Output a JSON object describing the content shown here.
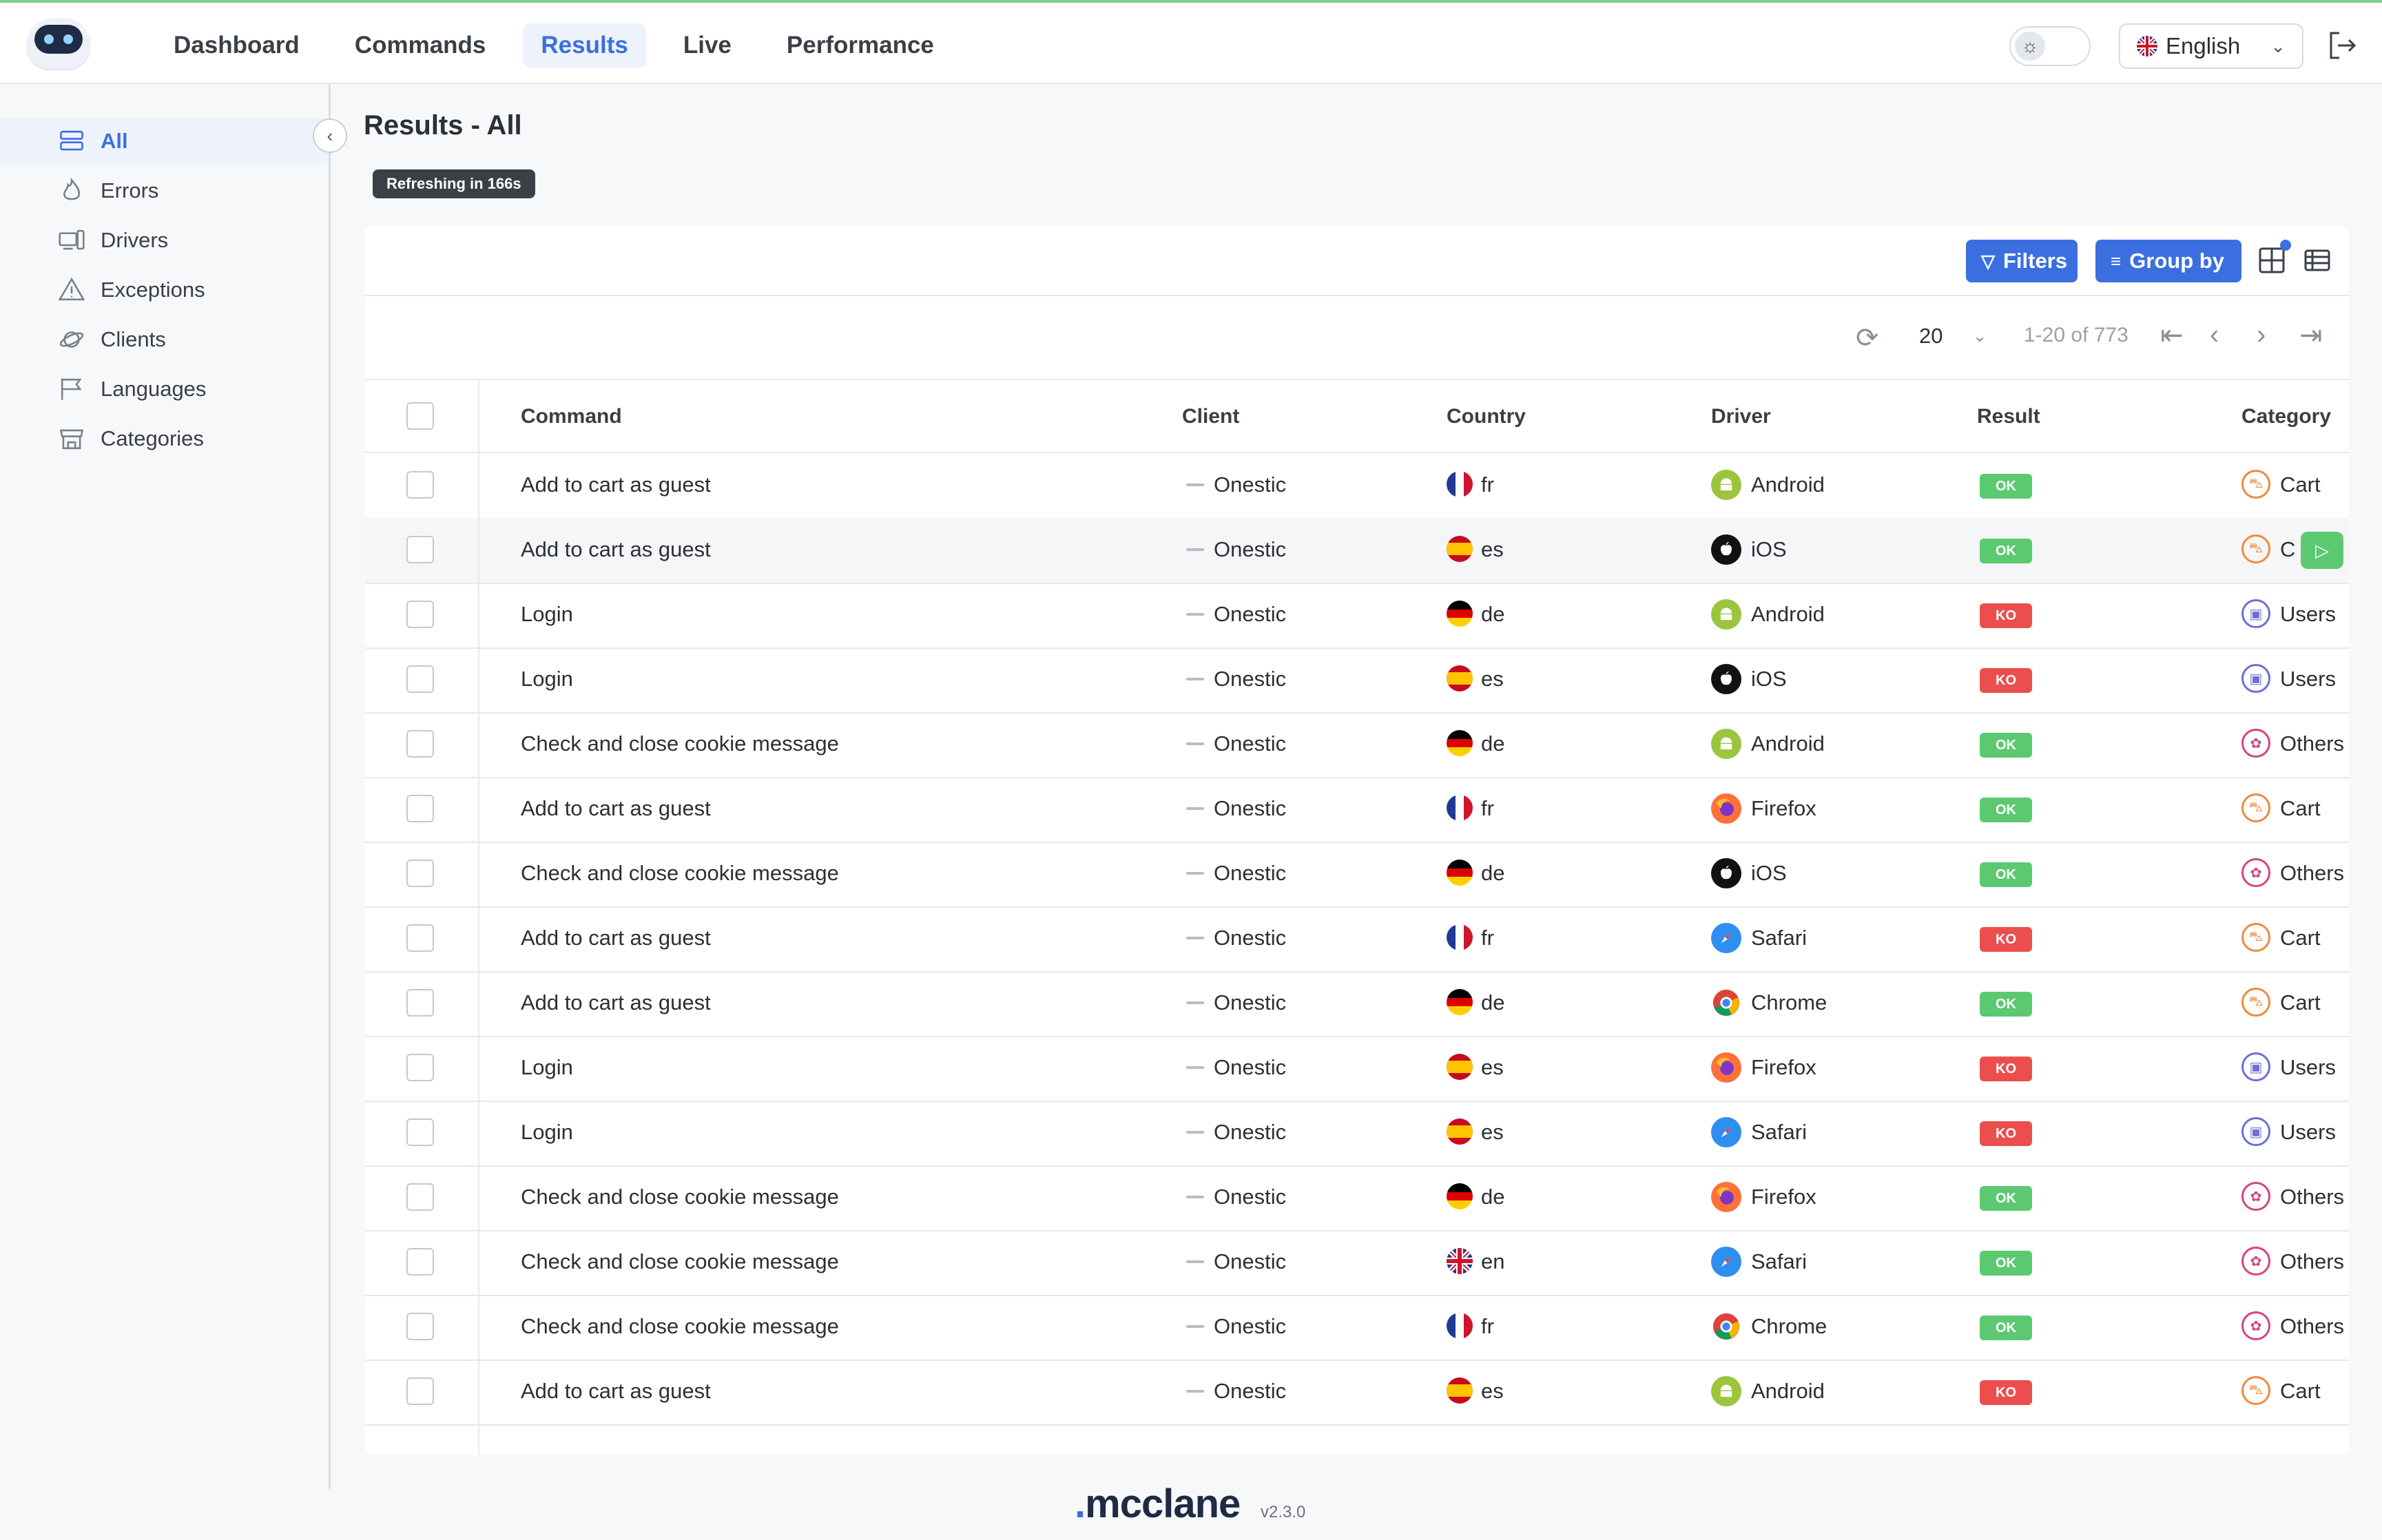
{
  "nav": {
    "items": [
      {
        "label": "Dashboard",
        "active": false
      },
      {
        "label": "Commands",
        "active": false
      },
      {
        "label": "Results",
        "active": true
      },
      {
        "label": "Live",
        "active": false
      },
      {
        "label": "Performance",
        "active": false
      }
    ],
    "language": "English",
    "icons": {
      "theme": "sun-icon",
      "logout": "logout-icon",
      "language": "uk-flag-icon"
    }
  },
  "sidebar": {
    "items": [
      {
        "label": "All",
        "icon": "list-icon",
        "active": true
      },
      {
        "label": "Errors",
        "icon": "fire-icon",
        "active": false
      },
      {
        "label": "Drivers",
        "icon": "devices-icon",
        "active": false
      },
      {
        "label": "Exceptions",
        "icon": "warning-icon",
        "active": false
      },
      {
        "label": "Clients",
        "icon": "planet-icon",
        "active": false
      },
      {
        "label": "Languages",
        "icon": "flag-icon",
        "active": false
      },
      {
        "label": "Categories",
        "icon": "store-icon",
        "active": false
      }
    ]
  },
  "page": {
    "title": "Results - All",
    "refresh": "Refreshing in 166s"
  },
  "toolbar": {
    "filters_label": "Filters",
    "groupby_label": "Group by"
  },
  "pager": {
    "page_size": "20",
    "range": "1-20 of 773"
  },
  "table": {
    "headers": {
      "command": "Command",
      "client": "Client",
      "country": "Country",
      "driver": "Driver",
      "result": "Result",
      "category": "Category"
    },
    "rows": [
      {
        "command": "Add to cart as guest",
        "client": "Onestic",
        "country": "fr",
        "driver": "Android",
        "result": "OK",
        "category": "Cart"
      },
      {
        "command": "Add to cart as guest",
        "client": "Onestic",
        "country": "es",
        "driver": "iOS",
        "result": "OK",
        "category": "C"
      },
      {
        "command": "Login",
        "client": "Onestic",
        "country": "de",
        "driver": "Android",
        "result": "KO",
        "category": "Users"
      },
      {
        "command": "Login",
        "client": "Onestic",
        "country": "es",
        "driver": "iOS",
        "result": "KO",
        "category": "Users"
      },
      {
        "command": "Check and close cookie message",
        "client": "Onestic",
        "country": "de",
        "driver": "Android",
        "result": "OK",
        "category": "Others"
      },
      {
        "command": "Add to cart as guest",
        "client": "Onestic",
        "country": "fr",
        "driver": "Firefox",
        "result": "OK",
        "category": "Cart"
      },
      {
        "command": "Check and close cookie message",
        "client": "Onestic",
        "country": "de",
        "driver": "iOS",
        "result": "OK",
        "category": "Others"
      },
      {
        "command": "Add to cart as guest",
        "client": "Onestic",
        "country": "fr",
        "driver": "Safari",
        "result": "KO",
        "category": "Cart"
      },
      {
        "command": "Add to cart as guest",
        "client": "Onestic",
        "country": "de",
        "driver": "Chrome",
        "result": "OK",
        "category": "Cart"
      },
      {
        "command": "Login",
        "client": "Onestic",
        "country": "es",
        "driver": "Firefox",
        "result": "KO",
        "category": "Users"
      },
      {
        "command": "Login",
        "client": "Onestic",
        "country": "es",
        "driver": "Safari",
        "result": "KO",
        "category": "Users"
      },
      {
        "command": "Check and close cookie message",
        "client": "Onestic",
        "country": "de",
        "driver": "Firefox",
        "result": "OK",
        "category": "Others"
      },
      {
        "command": "Check and close cookie message",
        "client": "Onestic",
        "country": "en",
        "driver": "Safari",
        "result": "OK",
        "category": "Others"
      },
      {
        "command": "Check and close cookie message",
        "client": "Onestic",
        "country": "fr",
        "driver": "Chrome",
        "result": "OK",
        "category": "Others"
      },
      {
        "command": "Add to cart as guest",
        "client": "Onestic",
        "country": "es",
        "driver": "Android",
        "result": "KO",
        "category": "Cart"
      }
    ]
  },
  "colors": {
    "accent": "#3b6fe0",
    "ok": "#5cc971",
    "ko": "#ec4e4e",
    "cart": "#f08a3c",
    "users": "#6b6fd6",
    "others": "#d6457a"
  },
  "footer": {
    "logo": "mcclane",
    "version": "v2.3.0"
  }
}
